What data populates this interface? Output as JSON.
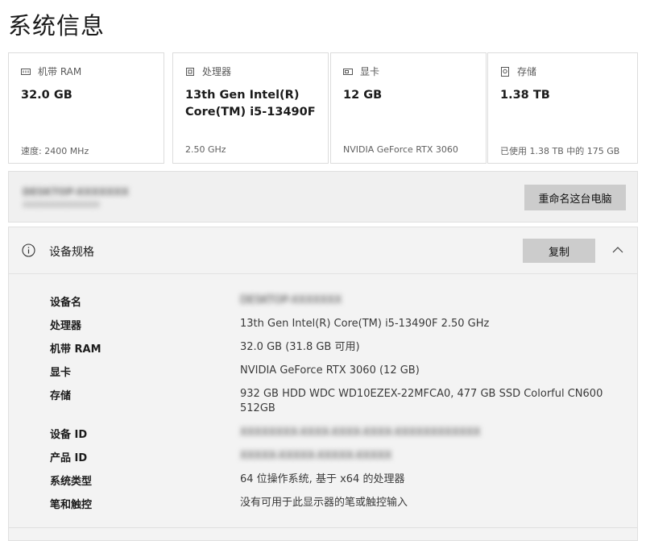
{
  "page": {
    "title": "系统信息"
  },
  "cards": [
    {
      "icon": "ram-icon",
      "label": "机带 RAM",
      "value": "32.0 GB",
      "sub": "速度: 2400 MHz"
    },
    {
      "icon": "cpu-icon",
      "label": "处理器",
      "value": "13th Gen Intel(R) Core(TM) i5-13490F",
      "sub": "2.50 GHz"
    },
    {
      "icon": "gpu-icon",
      "label": "显卡",
      "value": "12 GB",
      "sub": "NVIDIA GeForce RTX 3060"
    },
    {
      "icon": "storage-icon",
      "label": "存储",
      "value": "1.38 TB",
      "sub": "已使用 1.38 TB 中的 175 GB"
    }
  ],
  "device": {
    "name": "DESKTOP-XXXXXXX",
    "model": "XXXXXXXXXXXXXX",
    "rename_label": "重命名这台电脑"
  },
  "specs": {
    "title": "设备规格",
    "copy_label": "复制",
    "rows": [
      {
        "key": "设备名",
        "value": "DESKTOP-XXXXXXX",
        "blur": true
      },
      {
        "key": "处理器",
        "value": "13th Gen Intel(R) Core(TM) i5-13490F   2.50 GHz"
      },
      {
        "key": "机带 RAM",
        "value": "32.0 GB (31.8 GB 可用)"
      },
      {
        "key": "显卡",
        "value": "NVIDIA GeForce RTX 3060 (12 GB)"
      },
      {
        "key": "存储",
        "value": "932 GB HDD WDC WD10EZEX-22MFCA0, 477 GB SSD Colorful CN600 512GB"
      },
      {
        "key": "设备 ID",
        "value": "XXXXXXXX-XXXX-XXXX-XXXX-XXXXXXXXXXXX",
        "blur": true
      },
      {
        "key": "产品 ID",
        "value": "XXXXX-XXXXX-XXXXX-XXXXX",
        "blur": true
      },
      {
        "key": "系统类型",
        "value": "64 位操作系统, 基于 x64 的处理器"
      },
      {
        "key": "笔和触控",
        "value": "没有可用于此显示器的笔或触控输入"
      }
    ]
  }
}
